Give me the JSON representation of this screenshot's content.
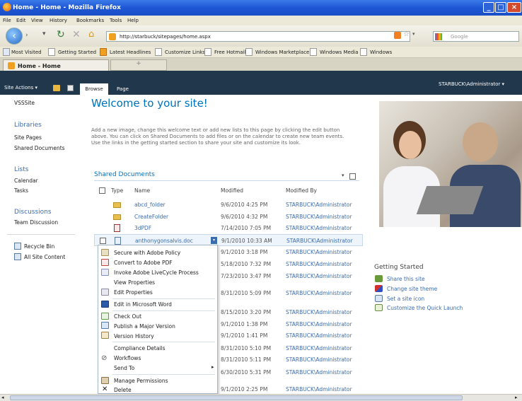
{
  "window": {
    "title": "Home - Home - Mozilla Firefox"
  },
  "menu": [
    "File",
    "Edit",
    "View",
    "History",
    "Bookmarks",
    "Tools",
    "Help"
  ],
  "nav": {
    "url": "http://starbuck/sitepages/home.aspx",
    "search_placeholder": "Google"
  },
  "bookmarks": [
    "Most Visited",
    "Getting Started",
    "Latest Headlines",
    "Customize Links",
    "Free Hotmail",
    "Windows Marketplace",
    "Windows Media",
    "Windows"
  ],
  "tabs": {
    "active": "Home - Home",
    "new_tab": "+"
  },
  "sp": {
    "site_actions": "Site Actions ▾",
    "user": "STARBUCK\\Administrator ▾",
    "ribbon_tabs": [
      "Browse",
      "Page"
    ]
  },
  "leftnav": {
    "top_item": "VSSSite",
    "libraries_heading": "Libraries",
    "libraries": [
      "Site Pages",
      "Shared Documents"
    ],
    "lists_heading": "Lists",
    "lists": [
      "Calendar",
      "Tasks"
    ],
    "discussions_heading": "Discussions",
    "discussions": [
      "Team Discussion"
    ],
    "recycle_bin": "Recycle Bin",
    "all_site_content": "All Site Content"
  },
  "main": {
    "title": "Welcome to your site!",
    "intro": "Add a new image, change this welcome text or add new lists to this page by clicking the edit button above. You can click on Shared Documents to add files or on the calendar to create new team events. Use the links in the getting started section to share your site and customize its look."
  },
  "shared_docs": {
    "heading": "Shared Documents",
    "columns": [
      "Type",
      "Name",
      "Modified",
      "Modified By"
    ],
    "rows": [
      {
        "name": "abcd_folder",
        "modified": "9/6/2010 4:25 PM",
        "by": "STARBUCK\\Administrator",
        "type": "folder"
      },
      {
        "name": "CreateFolder",
        "modified": "9/6/2010 4:32 PM",
        "by": "STARBUCK\\Administrator",
        "type": "folder"
      },
      {
        "name": "3dPDF",
        "modified": "7/14/2010 7:05 PM",
        "by": "STARBUCK\\Administrator",
        "type": "pdf"
      },
      {
        "name": "anthonygonsalvis.doc",
        "modified": "9/1/2010 10:33 AM",
        "by": "STARBUCK\\Administrator",
        "type": "doc"
      },
      {
        "name": "",
        "modified": "9/1/2010 3:18 PM",
        "by": "STARBUCK\\Administrator",
        "type": ""
      },
      {
        "name": "",
        "modified": "5/18/2010 7:32 PM",
        "by": "STARBUCK\\Administrator",
        "type": ""
      },
      {
        "name": "",
        "modified": "7/23/2010 3:47 PM",
        "by": "STARBUCK\\Administrator",
        "type": ""
      },
      {
        "name": "",
        "modified": "8/31/2010 5:09 PM",
        "by": "STARBUCK\\Administrator",
        "type": ""
      },
      {
        "name": "",
        "modified": "8/15/2010 3:20 PM",
        "by": "STARBUCK\\Administrator",
        "type": ""
      },
      {
        "name": "",
        "modified": "9/1/2010 1:38 PM",
        "by": "STARBUCK\\Administrator",
        "type": ""
      },
      {
        "name": "",
        "modified": "9/1/2010 1:41 PM",
        "by": "STARBUCK\\Administrator",
        "type": ""
      },
      {
        "name": "",
        "modified": "8/31/2010 5:10 PM",
        "by": "STARBUCK\\Administrator",
        "type": ""
      },
      {
        "name": "",
        "modified": "8/31/2010 5:11 PM",
        "by": "STARBUCK\\Administrator",
        "type": ""
      },
      {
        "name": "",
        "modified": "6/30/2010 5:31 PM",
        "by": "STARBUCK\\Administrator",
        "type": ""
      },
      {
        "name": "",
        "modified": "9/1/2010 2:25 PM",
        "by": "STARBUCK\\Administrator",
        "type": ""
      }
    ]
  },
  "context_menu": [
    "Secure with Adobe Policy",
    "Convert to Adobe PDF",
    "Invoke Adobe LiveCycle Process",
    "View Properties",
    "Edit Properties",
    "Edit in Microsoft Word",
    "Check Out",
    "Publish a Major Version",
    "Version History",
    "Compliance Details",
    "Workflows",
    "Send To",
    "Manage Permissions",
    "Delete"
  ],
  "getting_started": {
    "heading": "Getting Started",
    "links": [
      "Share this site",
      "Change site theme",
      "Set a site icon",
      "Customize the Quick Launch"
    ]
  }
}
